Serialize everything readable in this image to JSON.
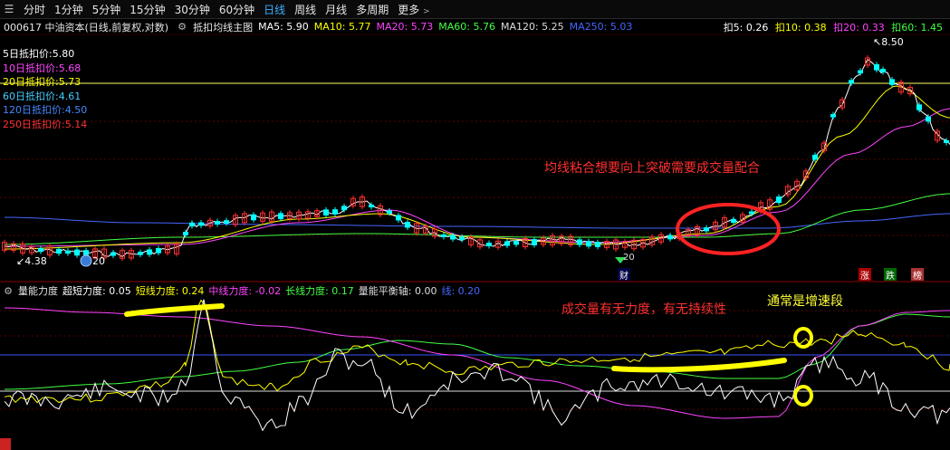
{
  "toolbar": {
    "tabs": [
      {
        "label": "分时",
        "active": false
      },
      {
        "label": "1分钟",
        "active": false
      },
      {
        "label": "5分钟",
        "active": false
      },
      {
        "label": "15分钟",
        "active": false
      },
      {
        "label": "30分钟",
        "active": false
      },
      {
        "label": "60分钟",
        "active": false
      },
      {
        "label": "日线",
        "active": true
      },
      {
        "label": "周线",
        "active": false
      },
      {
        "label": "月线",
        "active": false
      },
      {
        "label": "多周期",
        "active": false
      },
      {
        "label": "更多",
        "active": false
      }
    ],
    "more_caret": ">"
  },
  "info": {
    "stock": "000617 中油资本(日线,前复权,对数)",
    "formula": "抵扣均线主图",
    "ma5": "MA5: 5.90",
    "ma10": "MA10: 5.77",
    "ma20": "MA20: 5.73",
    "ma60": "MA60: 5.76",
    "ma120": "MA120: 5.25",
    "ma250": "MA250: 5.03",
    "k5": "扣5: 0.26",
    "k10": "扣10: 0.38",
    "k20": "扣20: 0.33",
    "k60": "扣60: 1.45"
  },
  "legend": [
    {
      "label": "5日抵扣价:5.80",
      "color": "#ffffff"
    },
    {
      "label": "10日抵扣价:5.68",
      "color": "#ff44ff"
    },
    {
      "label": "20日抵扣价:5.73",
      "color": "#ffff00"
    },
    {
      "label": "60日抵扣价:4.61",
      "color": "#44ff44"
    },
    {
      "label": "120日抵扣价:4.50",
      "color": "#4488ff"
    },
    {
      "label": "250日抵扣价:5.14",
      "color": "#ff3333"
    }
  ],
  "price_labels": {
    "high": "8.50",
    "low": "4.38",
    "circle_count": "20",
    "diamond": "20"
  },
  "tags": [
    "财",
    "涨",
    "跌",
    "榜"
  ],
  "annotations": {
    "upper": "均线粘合想要向上突破需要成交量配合",
    "lower": "成交量有无力度，有无持续性",
    "speed": "通常是增速段"
  },
  "lower_info": {
    "name": "量能力度",
    "ultra": "超短力度: 0.05",
    "short": "短线力度: 0.24",
    "mid": "中线力度: -0.02",
    "long": "长线力度: 0.17",
    "axis": "量能平衡轴: 0.00",
    "start": "线: 0.20"
  },
  "colors": {
    "ma5": "#ffffff",
    "ma10": "#ff44ff",
    "ma20": "#ffff00",
    "ma60": "#44ff44",
    "ma120": "#4466ff",
    "ma250": "#ff3333",
    "up": "#ff3030",
    "down": "#00ffff",
    "active_tab": "#3ab0ff",
    "highlight": "#ffff00"
  }
}
